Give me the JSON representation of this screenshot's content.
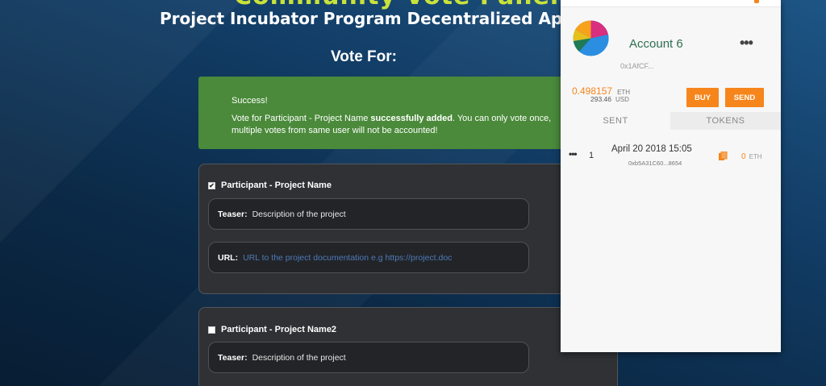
{
  "header": {
    "title": "Community Vote Panel",
    "subtitle": "Project Incubator Program Decentralized Application"
  },
  "vote_for": "Vote For:",
  "alert": {
    "heading": "Success!",
    "message_prefix": "Vote for Participant - Project Name ",
    "message_bold": "successfully added",
    "message_suffix": ". You can only vote once, multiple votes from same user will not be accounted!"
  },
  "participants": [
    {
      "checked": true,
      "name": "Participant - Project Name",
      "teaser_label": "Teaser:",
      "teaser_value": "Description of the project",
      "url_label": "URL:",
      "url_placeholder": "URL to the project documentation e.g https://project.doc"
    },
    {
      "checked": false,
      "name": "Participant - Project Name2",
      "teaser_label": "Teaser:",
      "teaser_value": "Description of the project"
    }
  ],
  "wallet": {
    "account_name": "Account 6",
    "address": "0x1AfCF...",
    "balance_eth": "0.498157",
    "eth_unit": "ETH",
    "balance_usd": "293.46",
    "usd_unit": "USD",
    "buy_label": "BUY",
    "send_label": "SEND",
    "tabs": [
      "SENT",
      "TOKENS"
    ],
    "transaction": {
      "nonce": "1",
      "date": "April 20 2018 15:05",
      "hash": "0xb5A31C60...8654",
      "amount": "0",
      "unit": "ETH"
    },
    "colors": {
      "accent": "#f6851b",
      "account_name": "#2f6f4f"
    }
  }
}
